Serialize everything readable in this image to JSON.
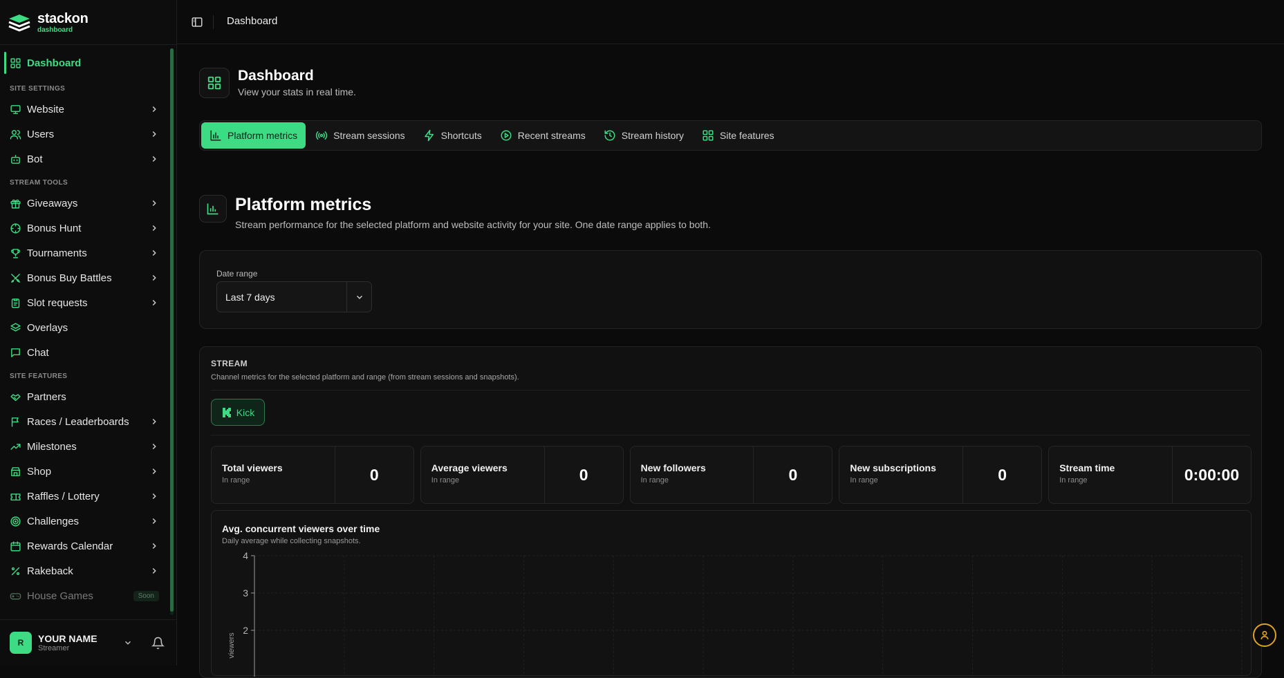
{
  "brand": {
    "name": "stackon",
    "sub": "dashboard"
  },
  "sidebar": {
    "active": {
      "label": "Dashboard",
      "icon": "grid-icon"
    },
    "sections": [
      {
        "title": "SITE SETTINGS",
        "items": [
          {
            "label": "Website",
            "icon": "monitor-icon",
            "chevron": true
          },
          {
            "label": "Users",
            "icon": "users-icon",
            "chevron": true
          },
          {
            "label": "Bot",
            "icon": "bot-icon",
            "chevron": true
          }
        ]
      },
      {
        "title": "STREAM TOOLS",
        "items": [
          {
            "label": "Giveaways",
            "icon": "gift-icon",
            "chevron": true
          },
          {
            "label": "Bonus Hunt",
            "icon": "crosshair-icon",
            "chevron": true
          },
          {
            "label": "Tournaments",
            "icon": "trophy-icon",
            "chevron": true
          },
          {
            "label": "Bonus Buy Battles",
            "icon": "swords-icon",
            "chevron": true
          },
          {
            "label": "Slot requests",
            "icon": "clipboard-icon",
            "chevron": true
          },
          {
            "label": "Overlays",
            "icon": "layers-icon",
            "chevron": false
          },
          {
            "label": "Chat",
            "icon": "chat-icon",
            "chevron": false
          }
        ]
      },
      {
        "title": "SITE FEATURES",
        "items": [
          {
            "label": "Partners",
            "icon": "handshake-icon",
            "chevron": false
          },
          {
            "label": "Races / Leaderboards",
            "icon": "flag-icon",
            "chevron": true
          },
          {
            "label": "Milestones",
            "icon": "trending-up-icon",
            "chevron": true
          },
          {
            "label": "Shop",
            "icon": "store-icon",
            "chevron": true
          },
          {
            "label": "Raffles / Lottery",
            "icon": "ticket-icon",
            "chevron": true
          },
          {
            "label": "Challenges",
            "icon": "target-icon",
            "chevron": true
          },
          {
            "label": "Rewards Calendar",
            "icon": "calendar-icon",
            "chevron": true
          },
          {
            "label": "Rakeback",
            "icon": "percent-icon",
            "chevron": true
          },
          {
            "label": "House Games",
            "icon": "gamepad-icon",
            "chevron": false,
            "badge": "Soon",
            "muted": true
          }
        ]
      }
    ]
  },
  "user": {
    "initial": "R",
    "name": "YOUR NAME",
    "role": "Streamer"
  },
  "topbar": {
    "title": "Dashboard"
  },
  "page": {
    "title": "Dashboard",
    "subtitle": "View your stats in real time."
  },
  "tabs": [
    {
      "label": "Platform metrics",
      "icon": "bar-chart-icon",
      "active": true
    },
    {
      "label": "Stream sessions",
      "icon": "broadcast-icon",
      "active": false
    },
    {
      "label": "Shortcuts",
      "icon": "zap-icon",
      "active": false
    },
    {
      "label": "Recent streams",
      "icon": "play-circle-icon",
      "active": false
    },
    {
      "label": "Stream history",
      "icon": "history-icon",
      "active": false
    },
    {
      "label": "Site features",
      "icon": "grid-icon",
      "active": false
    }
  ],
  "section": {
    "title": "Platform metrics",
    "subtitle": "Stream performance for the selected platform and website activity for your site. One date range applies to both."
  },
  "date_range": {
    "label": "Date range",
    "value": "Last 7 days"
  },
  "stream": {
    "label": "STREAM",
    "description": "Channel metrics for the selected platform and range (from stream sessions and snapshots).",
    "platform_button": "Kick",
    "stats": [
      {
        "name": "Total viewers",
        "range": "In range",
        "value": "0"
      },
      {
        "name": "Average viewers",
        "range": "In range",
        "value": "0"
      },
      {
        "name": "New followers",
        "range": "In range",
        "value": "0"
      },
      {
        "name": "New subscriptions",
        "range": "In range",
        "value": "0"
      },
      {
        "name": "Stream time",
        "range": "In range",
        "value": "0:00:00"
      }
    ]
  },
  "chart": {
    "title": "Avg. concurrent viewers over time",
    "subtitle": "Daily average while collecting snapshots.",
    "ylabel": "viewers",
    "yticks": [
      "4",
      "3",
      "2"
    ]
  },
  "chart_data": {
    "type": "line",
    "title": "Avg. concurrent viewers over time",
    "subtitle": "Daily average while collecting snapshots.",
    "xlabel": "",
    "ylabel": "viewers",
    "ylim": [
      0,
      4
    ],
    "yticks": [
      4,
      3,
      2
    ],
    "grid": true,
    "series": []
  },
  "colors": {
    "accent": "#3ddc84",
    "background": "#0b0b0b",
    "help": "#e0a321"
  }
}
